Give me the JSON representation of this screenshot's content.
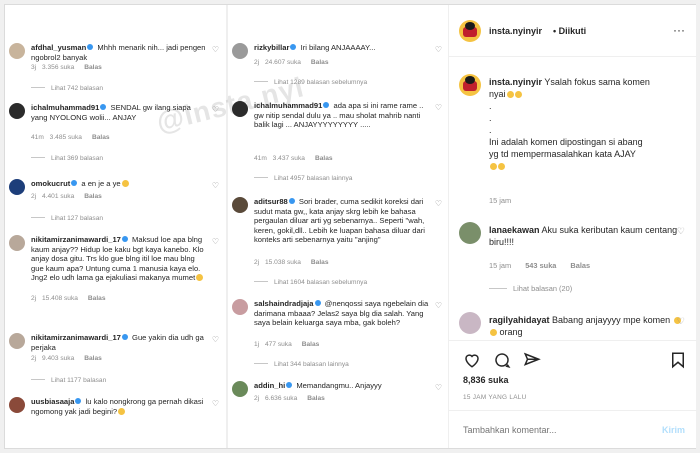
{
  "post": {
    "username": "insta.nyinyir",
    "follow_label": "• Diikuti",
    "more_label": "···",
    "likes": "8,836 suka",
    "time": "15 JAM YANG LALU",
    "add_placeholder": "Tambahkan komentar...",
    "send_label": "Kirim",
    "watermark": "@insta.nyi"
  },
  "caption": {
    "username": "insta.nyinyir",
    "lines": [
      "Ysalah fokus sama komen",
      "nyai",
      ".",
      ".",
      ".",
      "Ini adalah komen dipostingan si abang",
      "yg td mempermasalahkan kata AJAY"
    ],
    "time": "15 jam"
  },
  "side_comments": [
    {
      "username": "lanaekawan",
      "text": "Aku suka keributan kaum centang biru!!!!",
      "time": "15 jam",
      "likes": "543 suka",
      "reply": "Balas",
      "view_replies": "Lihat balasan (20)"
    },
    {
      "username": "ragilyahidayat",
      "text": "Babang anjayyyy mpe komen",
      "text2": "orang"
    }
  ],
  "col1": [
    {
      "username": "afdhal_yusman",
      "text": "Mhhh menarik nih... jadi pengen ngobrol2 banyak",
      "time": "3j",
      "likes": "3.356 suka",
      "reply": "Balas",
      "view": "Lihat 742 balasan"
    },
    {
      "username": "ichalmuhammad91",
      "text": "SENDAL gw ilang siapa yang NYOLONG wolii... ANJAY",
      "time": "41m",
      "likes": "3.485 suka",
      "reply": "Balas",
      "view": "Lihat 369 balasan"
    },
    {
      "username": "omokucrut",
      "text": "a en je a ye",
      "time": "2j",
      "likes": "4.401 suka",
      "reply": "Balas",
      "view": "Lihat 127 balasan"
    },
    {
      "username": "nikitamirzanimawardi_17",
      "text": "Maksud loe apa blng kaum anjay?? Hidup loe kaku bgt kaya kanebo. Klo anjay dosa gitu. Trs klo gue blng itil loe mau blng gue kaum apa? Untung cuma 1 manusia kaya elo. Jng2 elo udh lama ga ejakuliasi makanya mumet",
      "time": "2j",
      "likes": "15.408 suka",
      "reply": "Balas"
    },
    {
      "username": "nikitamirzanimawardi_17",
      "text": "Gue yakin dia udh ga perjaka",
      "time": "2j",
      "likes": "9.403 suka",
      "reply": "Balas",
      "view": "Lihat 1177 balasan"
    },
    {
      "username": "uusbiasaaja",
      "text": "lu kalo nongkrong ga pernah dikasi ngomong yak jadi begini?",
      "time": "2j",
      "likes": "",
      "reply": ""
    }
  ],
  "col2": [
    {
      "username": "rizkybillar",
      "text": "Iri bilang ANJAAAAY...",
      "time": "2j",
      "likes": "24.607 suka",
      "reply": "Balas",
      "view": "Lihat 1289 balasan sebelumnya"
    },
    {
      "username": "ichalmuhammad91",
      "text": "ada apa si ini rame rame .. gw nitip sendal dulu ya .. mau sholat mahrib nanti balik lagi ... ANJAYYYYYYYYY .....",
      "time": "41m",
      "likes": "3.437 suka",
      "reply": "Balas",
      "view": "Lihat 4957 balasan lainnya"
    },
    {
      "username": "aditsur88",
      "text": "Sori brader, cuma sedikit koreksi dari sudut mata gw,, kata anjay skrg lebih ke bahasa pergaulan diluar arti yg sebenarnya.. Seperti \"wah, keren, gokil,dll.. Lebih ke luapan bahasa diluar dari konteks arti sebenarnya yaitu \"anjing\"",
      "time": "2j",
      "likes": "15.038 suka",
      "reply": "Balas",
      "view": "Lihat 1604 balasan sebelumnya"
    },
    {
      "username": "salshaindradjaja",
      "text": "@nenqossi saya ngebelain dia darimana mbaaa? Jelas2 saya blg dia salah. Yang saya belain keluarga saya mba, gak boleh?",
      "time": "1j",
      "likes": "477 suka",
      "reply": "Balas",
      "view": "Lihat 344 balasan lainnya"
    },
    {
      "username": "addin_hi",
      "text": "Memandangmu.. Anjayyy",
      "time": "2j",
      "likes": "6.636 suka",
      "reply": "Balas"
    }
  ]
}
